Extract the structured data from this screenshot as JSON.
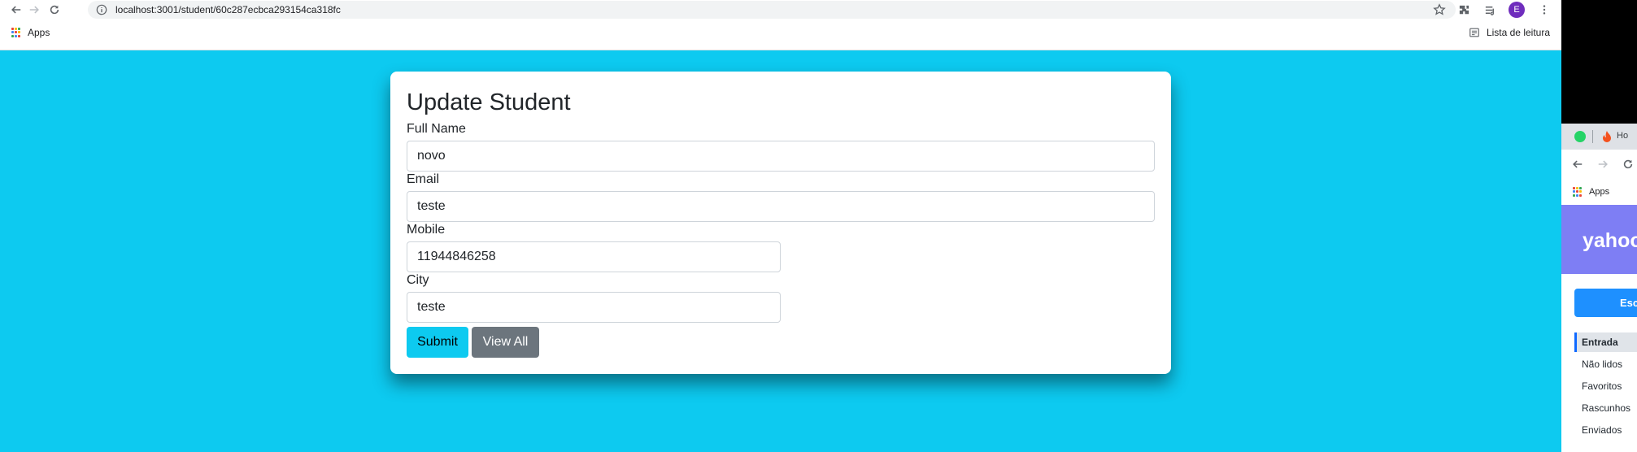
{
  "browser": {
    "url": "localhost:3001/student/60c287ecbca293154ca318fc",
    "profile_initial": "E",
    "profile_color": "#6f2dbd",
    "bookmarks": {
      "apps_label": "Apps",
      "reading_list_label": "Lista de leitura"
    }
  },
  "page": {
    "background": "#0dcaf0",
    "title": "Update Student",
    "fields": {
      "full_name": {
        "label": "Full Name",
        "value": "novo"
      },
      "email": {
        "label": "Email",
        "value": "teste"
      },
      "mobile": {
        "label": "Mobile",
        "value": "11944846258"
      },
      "city": {
        "label": "City",
        "value": "teste"
      }
    },
    "buttons": {
      "submit": "Submit",
      "view_all": "View All"
    }
  },
  "side_window": {
    "tab_label": "Ho",
    "apps_label": "Apps",
    "logo": "yahoo",
    "compose_label": "Escr",
    "folders": [
      "Entrada",
      "Não lidos",
      "Favoritos",
      "Rascunhos",
      "Enviados"
    ]
  }
}
